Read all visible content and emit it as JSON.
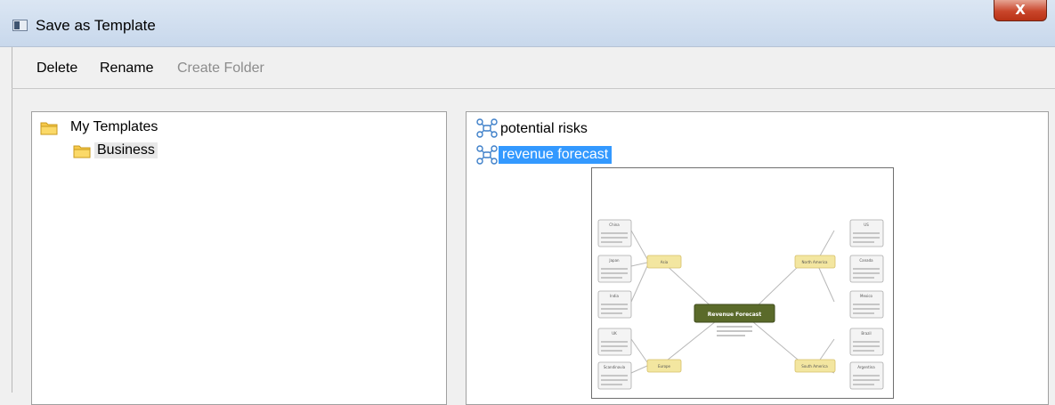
{
  "window": {
    "title": "Save as Template",
    "close_glyph": "X"
  },
  "toolbar": {
    "delete_label": "Delete",
    "rename_label": "Rename",
    "create_folder_label": "Create Folder"
  },
  "folders": [
    {
      "label": "My Templates",
      "icon": "folder-icon"
    },
    {
      "label": "Business",
      "icon": "folder-icon",
      "selected": true
    }
  ],
  "templates": [
    {
      "label": "potential risks",
      "icon": "mindmap-icon"
    },
    {
      "label": "revenue forecast",
      "icon": "mindmap-icon",
      "selected": true
    }
  ],
  "preview": {
    "central": "Revenue Forecast",
    "nodes": [
      "China",
      "Japan",
      "India",
      "Asia",
      "UK",
      "Scandinavia",
      "Europe",
      "North America",
      "US",
      "Canada",
      "Mexico",
      "South America",
      "Brazil",
      "Argentina"
    ]
  },
  "colors": {
    "selection": "#3399ff",
    "central_node": "#5a6a2a",
    "branch_node": "#f3e6a0"
  }
}
